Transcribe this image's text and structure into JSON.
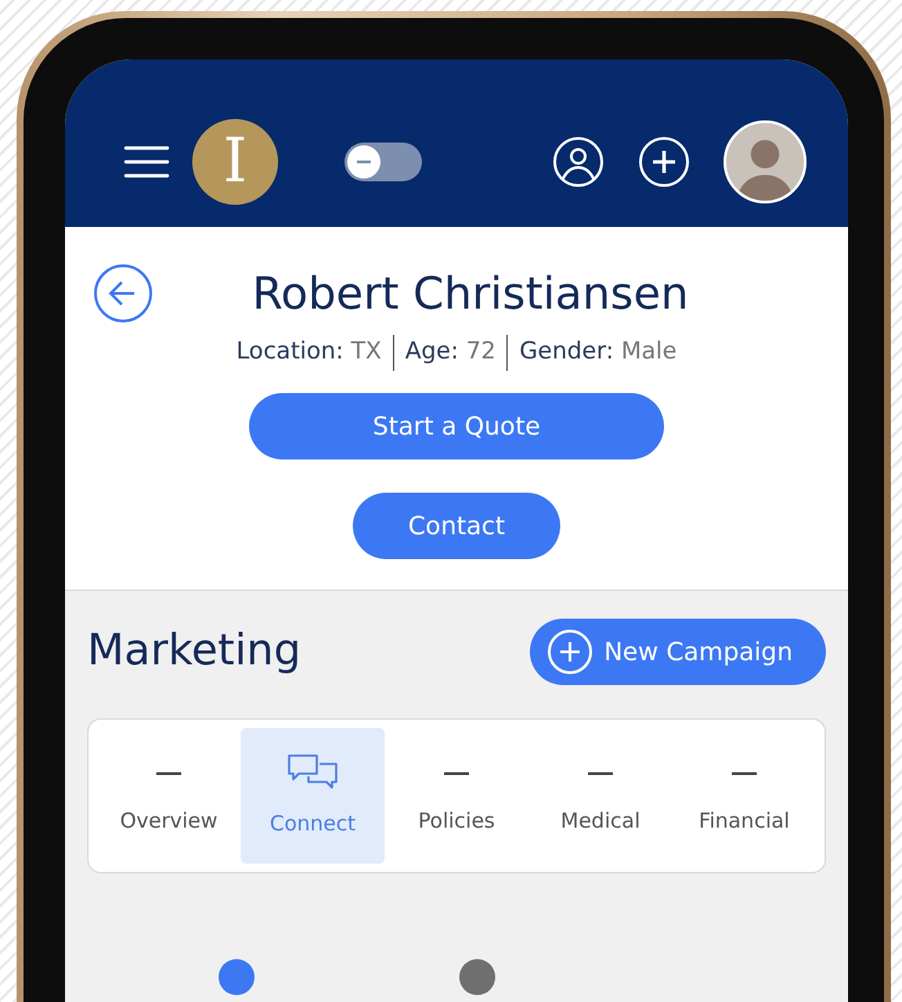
{
  "header": {
    "logo": {
      "text": "I"
    },
    "theme_toggle": {
      "on": false
    }
  },
  "patient": {
    "name": "Robert Christiansen",
    "facts": [
      {
        "label": "Location:",
        "value": "TX"
      },
      {
        "label": "Age:",
        "value": "72"
      },
      {
        "label": "Gender:",
        "value": "Male"
      }
    ]
  },
  "actions": [
    {
      "label": "Start a Quote",
      "kind": "wide"
    },
    {
      "label": "Contact",
      "kind": "narrow"
    }
  ],
  "marketing": {
    "title": "Marketing",
    "button": "New Campaign",
    "tabs": [
      {
        "label": "Overview",
        "selected": false
      },
      {
        "label": "Connect",
        "selected": true
      },
      {
        "label": "Policies",
        "selected": false
      },
      {
        "label": "Medical",
        "selected": false
      },
      {
        "label": "Financial",
        "selected": false
      }
    ],
    "steps": [
      {
        "color": "#3b78f2"
      },
      {
        "color": "#6f6f6f"
      }
    ]
  }
}
